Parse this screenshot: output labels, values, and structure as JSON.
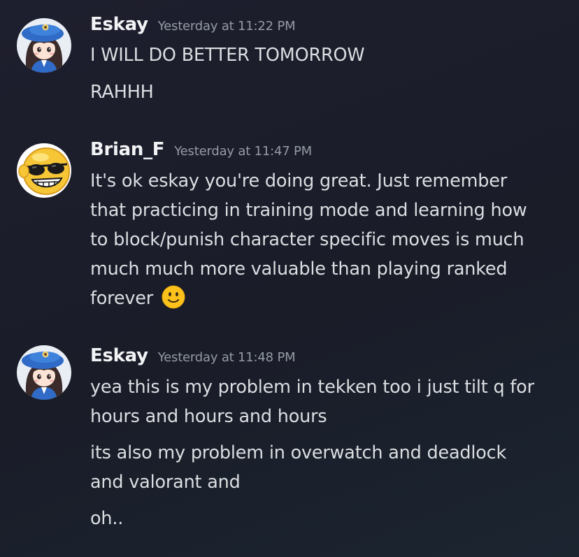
{
  "messages": [
    {
      "author": "Eskay",
      "timestamp": "Yesterday at 11:22 PM",
      "avatar": "eskay-avatar-icon",
      "lines": [
        "I WILL DO BETTER TOMORROW",
        "RAHHH"
      ]
    },
    {
      "author": "Brian_F",
      "timestamp": "Yesterday at 11:47 PM",
      "avatar": "sunglasses-smiley-avatar-icon",
      "lines": [
        "It's ok eskay you're doing great. Just remember",
        "that practicing in training mode and learning how",
        "to block/punish character specific moves is much",
        "much much more valuable than playing ranked",
        "forever"
      ],
      "emoji": "slightly-smiling-face-icon"
    },
    {
      "author": "Eskay",
      "timestamp": "Yesterday at 11:48 PM",
      "avatar": "eskay-avatar-icon",
      "lines": [
        "yea this is my problem in tekken too i just tilt q for",
        "hours and hours and hours",
        "its also my problem in overwatch and deadlock",
        "and valorant and",
        "oh.."
      ]
    }
  ],
  "colors": {
    "background": "#1e1f2e",
    "author": "#f2f3f5",
    "timestamp": "#949ba4",
    "message_text": "#dbdee1"
  }
}
